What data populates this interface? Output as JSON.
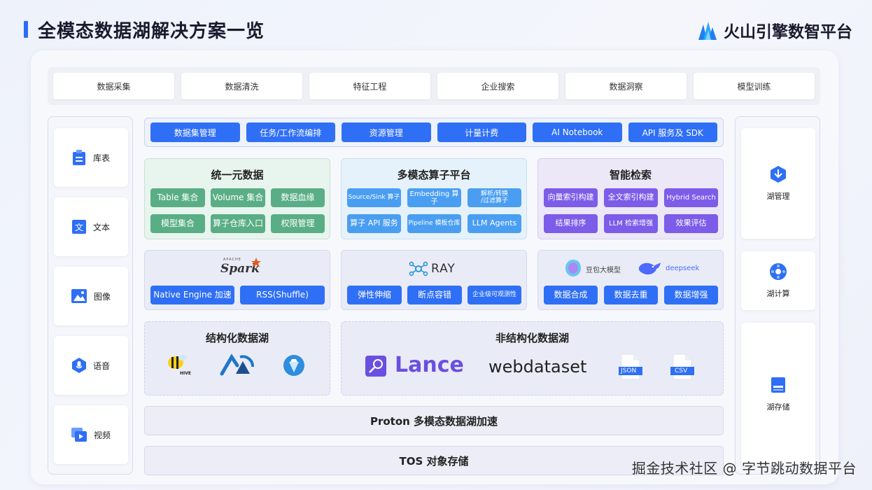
{
  "title": "全模态数据湖解决方案一览",
  "brand": "火山引擎数智平台",
  "top_row": [
    "数据采集",
    "数据清洗",
    "特征工程",
    "企业搜索",
    "数据洞察",
    "模型训练"
  ],
  "left_items": [
    "库表",
    "文本",
    "图像",
    "语音",
    "视频"
  ],
  "right_items": [
    "湖管理",
    "湖计算",
    "湖存储"
  ],
  "service_row": [
    "数据集管理",
    "任务/工作流编排",
    "资源管理",
    "计量计费",
    "AI Notebook",
    "API 服务及 SDK"
  ],
  "unified": {
    "title": "统一元数据",
    "items": [
      "Table 集合",
      "Volume 集合",
      "数据血缘",
      "模型集合",
      "算子仓库入口",
      "权限管理"
    ]
  },
  "operator": {
    "title": "多模态算子平台",
    "items": [
      "Source/Sink 算子",
      "Embedding 算子",
      "解析/转换\n/过滤算子",
      "算子 API 服务",
      "Pipeline 模板仓库",
      "LLM Agents"
    ]
  },
  "search": {
    "title": "智能检索",
    "items": [
      "向量索引构建",
      "全文索引构建",
      "Hybrid Search",
      "结果排序",
      "LLM 检索增强",
      "效果评估"
    ]
  },
  "spark": {
    "logo": "Spark",
    "logo_top": "APACHE",
    "items": [
      "Native Engine 加速",
      "RSS(Shuffle)"
    ]
  },
  "ray": {
    "logo": "RAY",
    "items": [
      "弹性伸缩",
      "断点容错",
      "企业级可观测性"
    ]
  },
  "llm": {
    "logo1": "豆包大模型",
    "logo2": "deepseek",
    "items": [
      "数据合成",
      "数据去重",
      "数据增强"
    ]
  },
  "structured": {
    "title": "结构化数据湖",
    "hive_label": "HIVE"
  },
  "unstructured": {
    "title": "非结构化数据湖",
    "lance": "Lance",
    "webdataset": "webdataset",
    "json": "JSON",
    "csv": "CSV"
  },
  "proton": "Proton 多模态数据湖加速",
  "tos": "TOS 对象存储",
  "watermark": "掘金技术社区 @ 字节跳动数据平台",
  "colors": {
    "accent": "#2f6ff5",
    "green": "#5aae85",
    "light_blue": "#4a9ef2",
    "purple": "#7c5ce8"
  }
}
